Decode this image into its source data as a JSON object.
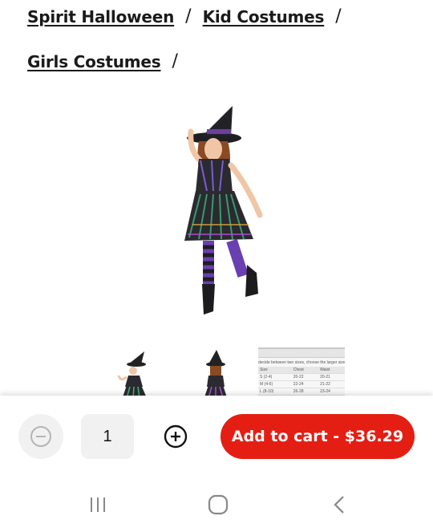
{
  "breadcrumb": {
    "items": [
      {
        "label": "Spirit Halloween"
      },
      {
        "label": "Kid Costumes"
      },
      {
        "label": "Girls Costumes"
      }
    ],
    "separator": "/"
  },
  "product": {
    "main_image_icon": "witch-costume-image",
    "thumbnails": [
      {
        "icon": "witch-costume-front-thumbnail"
      },
      {
        "icon": "witch-costume-back-thumbnail"
      },
      {
        "icon": "size-chart-thumbnail"
      }
    ],
    "size_chart": {
      "note": "decide between two sizes, choose the larger size",
      "headers": [
        "Size",
        "Chest",
        "Waist"
      ],
      "rows": [
        [
          "S (2-4)",
          "20-22",
          "20-21"
        ],
        [
          "M (4-6)",
          "22-24",
          "21-22"
        ],
        [
          "L (8-10)",
          "26-28",
          "23-24"
        ]
      ]
    }
  },
  "purchase": {
    "quantity": "1",
    "add_to_cart_label": "Add to cart - $36.29",
    "accent_color": "#e51e14"
  },
  "system_nav": {
    "recent_icon": "recent-apps-icon",
    "home_icon": "home-icon",
    "back_icon": "back-icon"
  }
}
